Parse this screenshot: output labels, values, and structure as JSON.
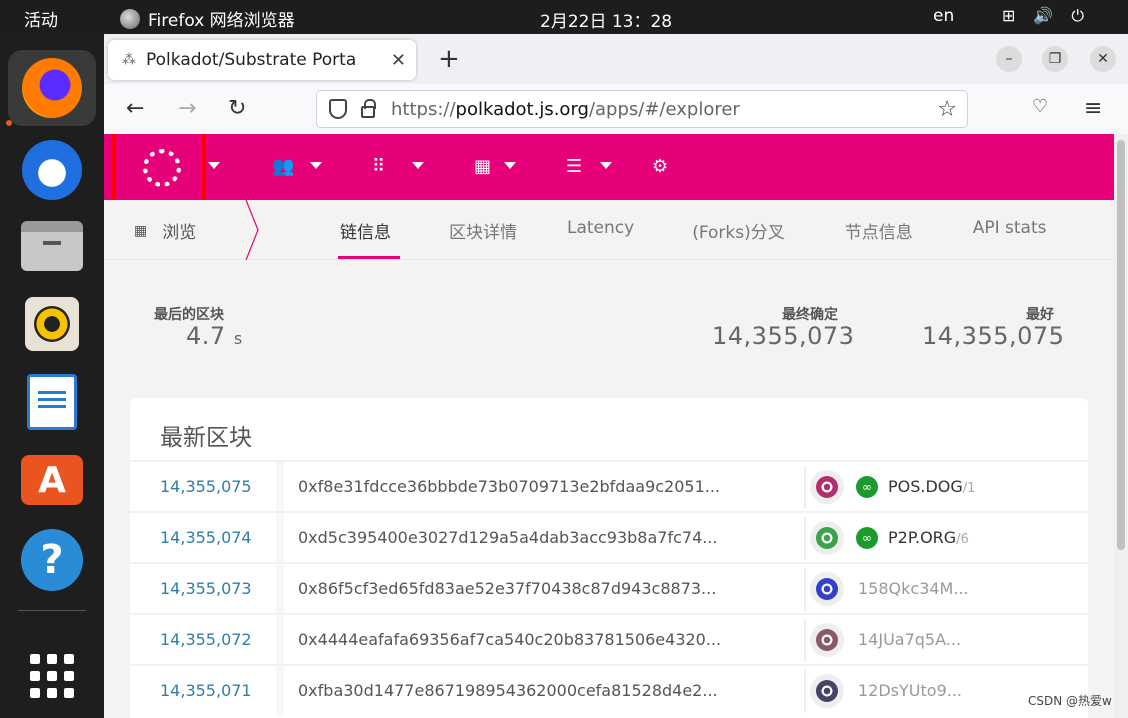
{
  "topbar": {
    "activities": "活动",
    "app_name": "Firefox 网络浏览器",
    "clock": "2月22日  13：28",
    "lang": "en"
  },
  "dock": {
    "items": [
      "firefox",
      "thunderbird",
      "files",
      "rhythmbox",
      "writer",
      "software",
      "help"
    ]
  },
  "browser": {
    "tab_title": "Polkadot/Substrate Porta",
    "new_tab": "+",
    "url_prefix": "https://",
    "url_host": "polkadot.js.org",
    "url_path": "/apps/#/explorer"
  },
  "app": {
    "accent": "#e6007a",
    "subnav": {
      "browse": "浏览",
      "tabs": [
        "链信息",
        "区块详情",
        "Latency",
        "(Forks)分叉",
        "节点信息",
        "API stats"
      ]
    },
    "summary": {
      "last_block_label": "最后的区块",
      "last_block_value": "4.7",
      "last_block_unit": "s",
      "finalized_label": "最终确定",
      "finalized_value": "14,355,073",
      "best_label": "最好",
      "best_value": "14,355,075"
    },
    "recent_blocks": {
      "title": "最新区块",
      "rows": [
        {
          "number": "14,355,075",
          "hash": "0xf8e31fdcce36bbbde73b0709713e2bfdaa9c2051...",
          "author": "POS.DOG",
          "author_suffix": "/1",
          "verified": true,
          "avatar_color": "#b0306f"
        },
        {
          "number": "14,355,074",
          "hash": "0xd5c395400e3027d129a5a4dab3acc93b8a7fc74...",
          "author": "P2P.ORG",
          "author_suffix": "/6",
          "verified": true,
          "avatar_color": "#3ba34b"
        },
        {
          "number": "14,355,073",
          "hash": "0x86f5cf3ed65fd83ae52e37f70438c87d943c8873...",
          "author": "158Qkc34M...",
          "author_suffix": "",
          "verified": false,
          "avatar_color": "#3340c8"
        },
        {
          "number": "14,355,072",
          "hash": "0x4444eafafa69356af7ca540c20b83781506e4320...",
          "author": "14JUa7q5A...",
          "author_suffix": "",
          "verified": false,
          "avatar_color": "#8a5a6a"
        },
        {
          "number": "14,355,071",
          "hash": "0xfba30d1477e867198954362000cefa81528d4e2...",
          "author": "12DsYUto9...",
          "author_suffix": "",
          "verified": false,
          "avatar_color": "#444466"
        }
      ]
    }
  },
  "watermark": "CSDN @热爱w"
}
